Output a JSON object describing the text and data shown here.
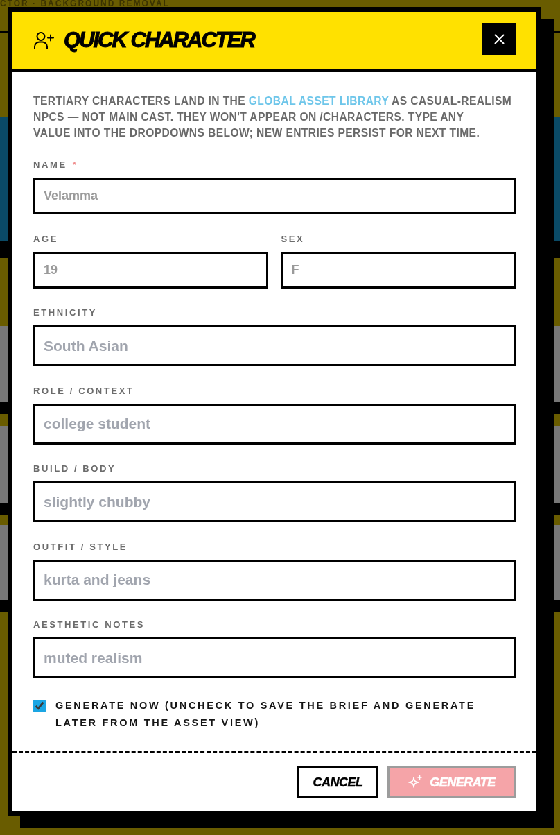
{
  "backdrop": {
    "breadcrumb": "CTOR · BACKGROUND REMOVAL"
  },
  "dialog": {
    "title": "QUICK CHARACTER",
    "intro_lines": [
      [
        {
          "kind": "text",
          "text": "TERTIARY CHARACTERS LAND IN THE "
        },
        {
          "kind": "link",
          "text": "GLOBAL ASSET LIBRARY"
        },
        {
          "kind": "text",
          "text": " AS CASUAL-REALISM"
        }
      ],
      [
        {
          "kind": "text",
          "text": "NPCS — NOT MAIN CAST. THEY WON'T APPEAR ON /CHARACTERS. TYPE ANY"
        }
      ],
      [
        {
          "kind": "text",
          "text": "VALUE INTO THE DROPDOWNS BELOW; NEW ENTRIES PERSIST FOR NEXT TIME."
        }
      ]
    ],
    "field_rows": [
      [
        {
          "kind": "text",
          "label": "NAME",
          "required_mark": "*",
          "placeholder": "Velamma"
        }
      ],
      [
        {
          "kind": "text",
          "label": "AGE",
          "placeholder": "19"
        },
        {
          "kind": "text",
          "label": "SEX",
          "placeholder": "F"
        }
      ],
      [
        {
          "kind": "combo",
          "label": "ETHNICITY",
          "placeholder": "South Asian"
        }
      ],
      [
        {
          "kind": "combo",
          "label": "ROLE / CONTEXT",
          "placeholder": "college student"
        }
      ],
      [
        {
          "kind": "combo",
          "label": "BUILD / BODY",
          "placeholder": "slightly chubby"
        }
      ],
      [
        {
          "kind": "combo",
          "label": "OUTFIT / STYLE",
          "placeholder": "kurta and jeans"
        }
      ],
      [
        {
          "kind": "combo",
          "label": "AESTHETIC NOTES",
          "placeholder": "muted realism"
        }
      ]
    ],
    "generate_now": {
      "label": "GENERATE NOW (UNCHECK TO SAVE THE BRIEF AND GENERATE LATER FROM THE ASSET VIEW)",
      "checked": true
    },
    "buttons": [
      {
        "kind": "cancel",
        "label": "CANCEL",
        "disabled": false
      },
      {
        "kind": "generate",
        "label": "GENERATE",
        "disabled": true
      }
    ]
  }
}
